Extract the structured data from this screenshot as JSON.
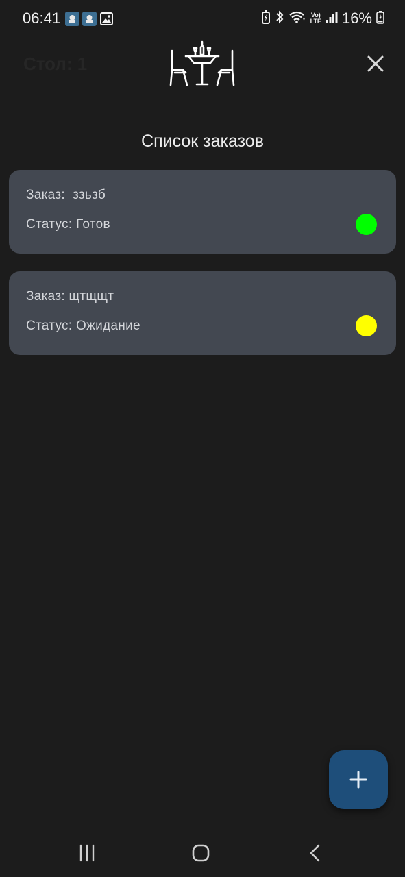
{
  "status_bar": {
    "time": "06:41",
    "battery": "16%",
    "notification_icons": [
      "app-notification-icon",
      "app-notification-icon",
      "image-icon"
    ],
    "system_icons": [
      "battery-saver-icon",
      "bluetooth-icon",
      "wifi-icon",
      "volte-icon",
      "signal-icon",
      "battery-icon"
    ],
    "volte_label_top": "Vo)",
    "volte_label_bottom": "LTE"
  },
  "header": {
    "table_title": "Стол: 1",
    "logo_icon": "restaurant-table-icon",
    "close_icon": "close-icon"
  },
  "main": {
    "title": "Список заказов",
    "orders": [
      {
        "order_line": "Заказ:  ззьзб",
        "status_line": "Статус: Готов",
        "status_color": "#00ff00"
      },
      {
        "order_line": "Заказ: щтщщт",
        "status_line": "Статус: Ожидание",
        "status_color": "#ffff00"
      }
    ]
  },
  "fab": {
    "icon": "plus-icon"
  },
  "nav_bar": {
    "icons": [
      "recent-apps-icon",
      "home-icon",
      "back-icon"
    ]
  },
  "colors": {
    "background": "#1c1c1c",
    "card": "#434851",
    "fab": "#1e4e7a",
    "ready": "#00ff00",
    "waiting": "#ffff00"
  }
}
